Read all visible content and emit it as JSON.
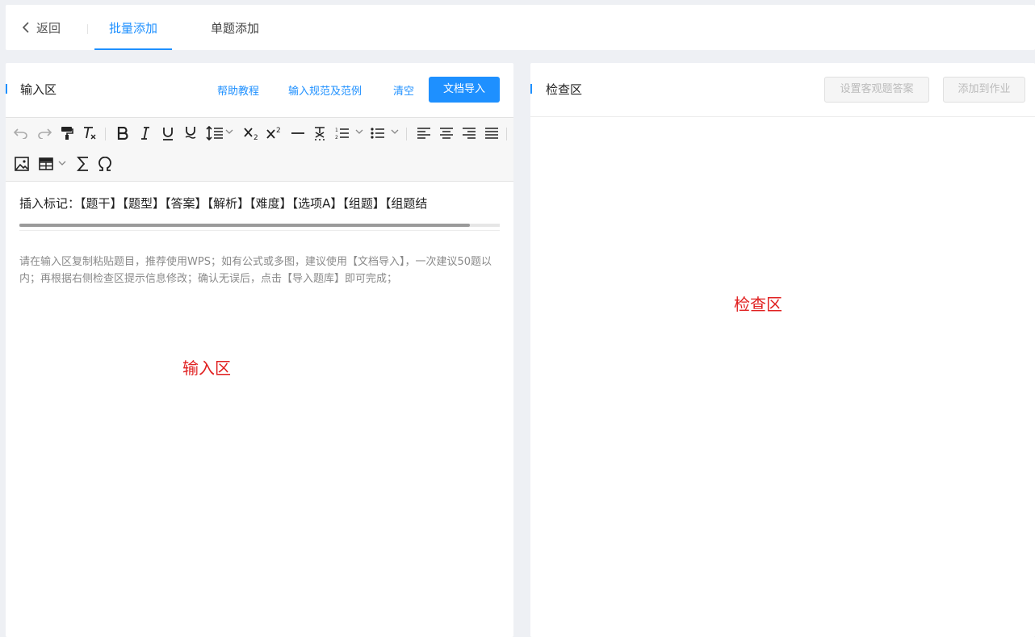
{
  "topbar": {
    "back_label": "返回",
    "tabs": [
      {
        "label": "批量添加",
        "active": true
      },
      {
        "label": "单题添加",
        "active": false
      }
    ]
  },
  "input_panel": {
    "title": "输入区",
    "links": [
      "帮助教程",
      "输入规范及范例",
      "清空"
    ],
    "import_button": "文档导入",
    "toolbar_icons": [
      "undo-icon",
      "redo-icon",
      "format-painter-icon",
      "clear-format-icon",
      "bold-icon",
      "italic-icon",
      "underline-icon",
      "double-underline-icon",
      "line-height-icon",
      "subscript-icon",
      "superscript-icon",
      "horizontal-rule-icon",
      "emphasis-mark-icon",
      "ordered-list-icon",
      "unordered-list-icon",
      "align-left-icon",
      "align-center-icon",
      "align-right-icon",
      "justify-icon",
      "image-icon",
      "table-icon",
      "sigma-icon",
      "omega-icon"
    ],
    "marker_prefix": "插入标记：",
    "markers": [
      "【题干】",
      "【题型】",
      "【答案】",
      "【解析】",
      "【难度】",
      "【选项A】",
      "【组题】",
      "【组题结"
    ],
    "hint": "请在输入区复制粘贴题目，推荐使用WPS；如有公式或多图，建议使用【文档导入】，一次建议50题以内；再根据右侧检查区提示信息修改；确认无误后，点击【导入题库】即可完成；",
    "overlay_label": "输入区"
  },
  "check_panel": {
    "title": "检查区",
    "subjective_button": "设置客观题答案",
    "add_button": "添加到作业",
    "overlay_label": "检查区"
  },
  "colors": {
    "accent": "#1e90ff",
    "overlay_label": "#e02020",
    "background": "#eef0f4"
  }
}
